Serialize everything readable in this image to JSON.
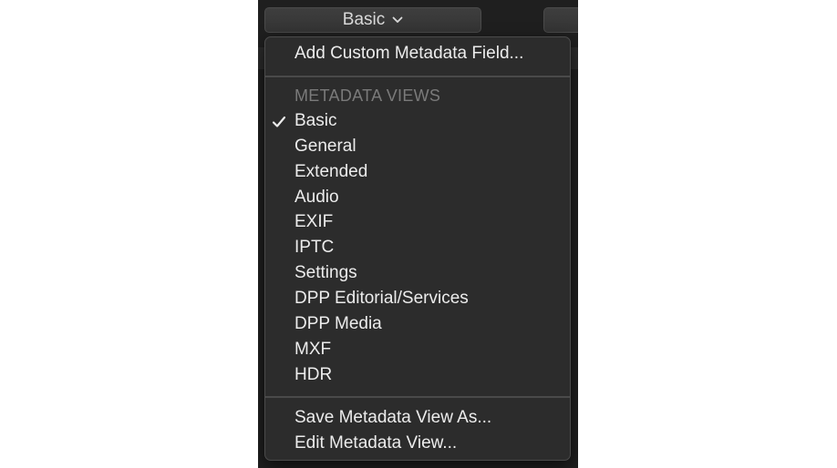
{
  "view_selector": {
    "label": "Basic",
    "chevron_icon": "chevron-down-icon"
  },
  "menu": {
    "add_custom_field": "Add Custom Metadata Field...",
    "section_header": "METADATA VIEWS",
    "checkmark_icon": "checkmark-icon",
    "selected_view": "Basic",
    "views": [
      {
        "label": "Basic"
      },
      {
        "label": "General"
      },
      {
        "label": "Extended"
      },
      {
        "label": "Audio"
      },
      {
        "label": "EXIF"
      },
      {
        "label": "IPTC"
      },
      {
        "label": "Settings"
      },
      {
        "label": "DPP Editorial/Services"
      },
      {
        "label": "DPP Media"
      },
      {
        "label": "MXF"
      },
      {
        "label": "HDR"
      }
    ],
    "save_view_as": "Save Metadata View As...",
    "edit_view": "Edit Metadata View..."
  },
  "colors": {
    "menu_background": "#2c2c2c",
    "menu_text": "#ececec",
    "header_text": "#7a7a7a",
    "panel_background": "#1f1f1f"
  }
}
